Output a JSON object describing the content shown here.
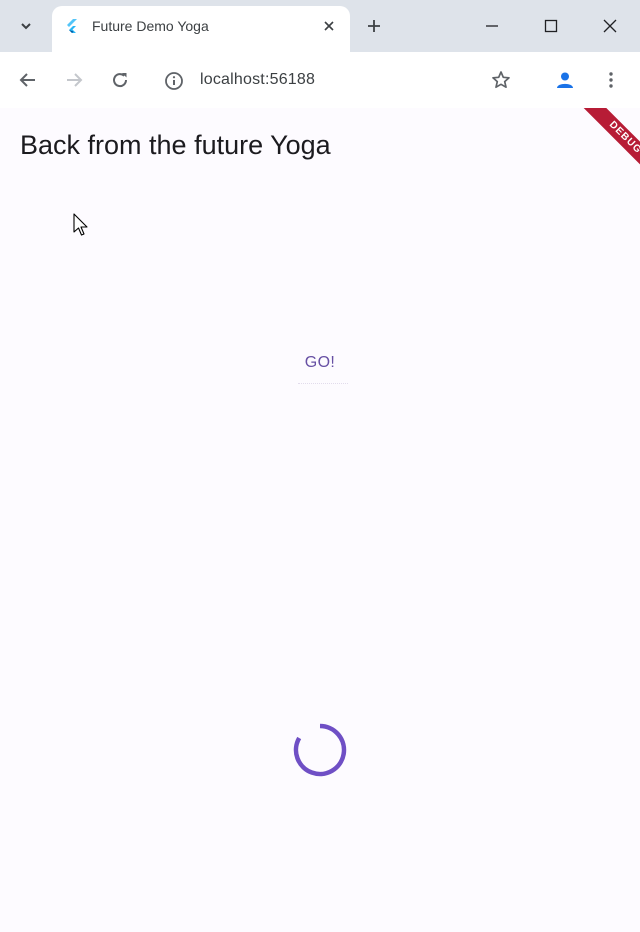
{
  "browser": {
    "tab": {
      "title": "Future Demo Yoga",
      "favicon": "flutter-icon"
    },
    "address_bar": {
      "url": "localhost:56188"
    },
    "icons": {
      "tab_search": "chevron-down-icon",
      "tab_close": "close-icon",
      "new_tab": "plus-icon",
      "minimize": "minimize-icon",
      "maximize": "maximize-icon",
      "close_window": "close-icon",
      "back": "back-arrow-icon",
      "forward": "forward-arrow-icon",
      "reload": "reload-icon",
      "site_info": "info-icon",
      "bookmark": "star-icon",
      "profile": "person-icon",
      "menu": "more-vert-icon"
    }
  },
  "app": {
    "title": "Back from the future Yoga",
    "go_button_label": "GO!",
    "debug_banner": "DEBUG",
    "loading": "spinner"
  },
  "colors": {
    "tab_strip": "#dee3ea",
    "page_background": "#fdfbff",
    "primary": "#6750a4",
    "spinner": "#6f4fc5",
    "debug_banner": "#b71c36",
    "profile_icon": "#1a73e8"
  }
}
